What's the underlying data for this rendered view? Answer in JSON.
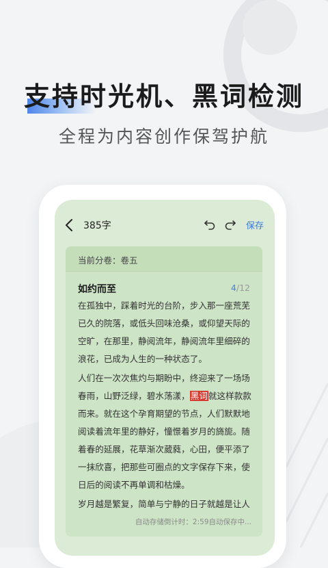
{
  "promo": {
    "headline": "支持时光机、黑词检测",
    "subheadline": "全程为内容创作保驾护航"
  },
  "editor": {
    "word_count": "385字",
    "save_label": "保存",
    "icons": {
      "back": "chevron-left-icon",
      "undo": "undo-icon",
      "redo": "redo-icon"
    },
    "volume_label": "当前分卷：卷五",
    "chapter_title": "如约而至",
    "chapter_current": "4",
    "chapter_total": "/12",
    "paragraph1": "在孤独中，踩着时光的台阶，步入那一座荒芜已久的院落，或低头回味沧桑，或仰望天际的空旷，在那里，静阅流年，静阅流年里细碎的浪花，已成为人生的一种状态了。",
    "paragraph2_before": "人们在一次次焦灼与期盼中，终迎来了一场场春雨，山野泛绿，碧水荡漾，",
    "paragraph2_black_word": "黑词",
    "paragraph2_after": "就这样款款而来。就在这个孕育期望的节点，人们默默地阅读着流年里的静好，憧憬着岁月的旖旎。随着春的延展，花草渐次葳蕤，心田，便平添了一抹欣喜，把那些可圈点的文字保存下来，使日后的阅读不再单调和枯燥。",
    "paragraph3": "岁月越是繁复，简单与宁静的日子就越是让人",
    "autosave_status": "自动存储倒计时：2:59自动保存中..."
  },
  "colors": {
    "accent": "#3a7be0",
    "screen_bg": "#dcebd6",
    "card_bg": "#cde4c6",
    "black_word_highlight": "#d8382d"
  }
}
